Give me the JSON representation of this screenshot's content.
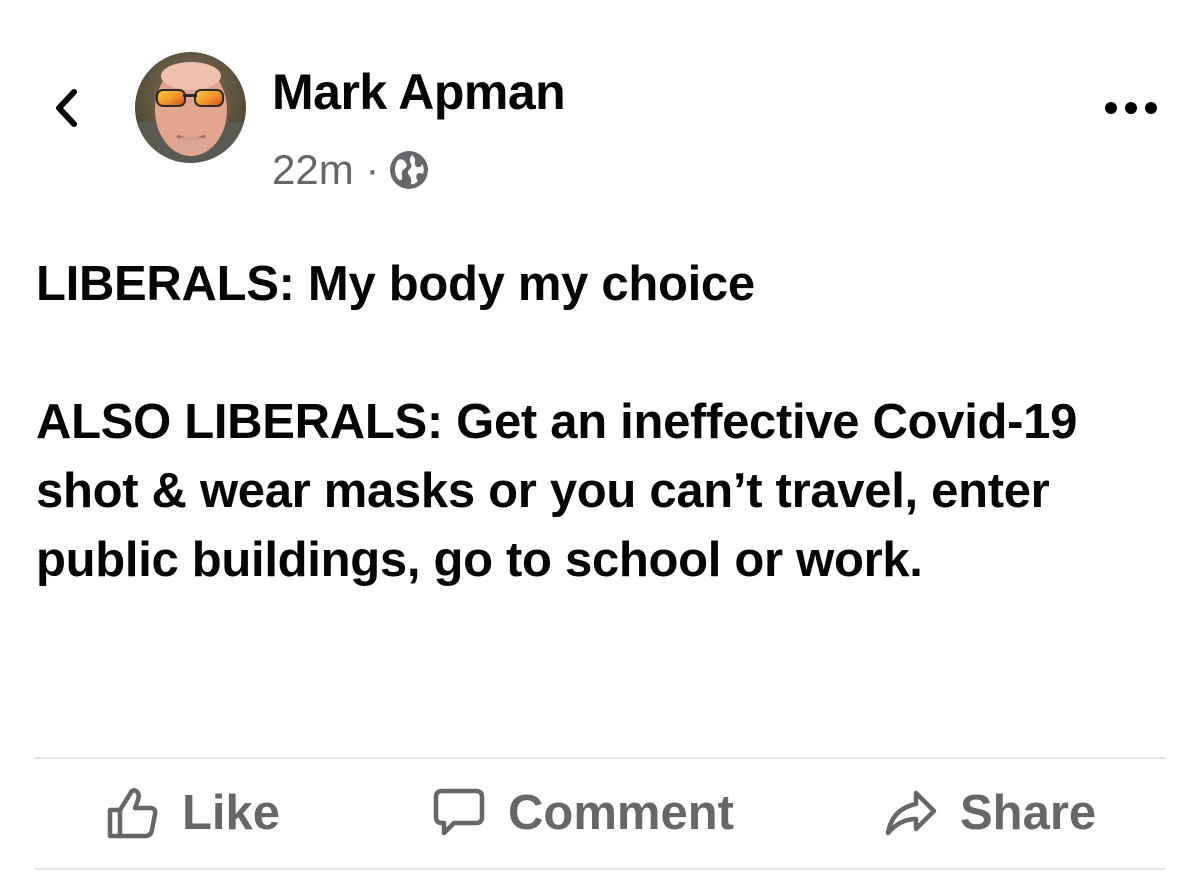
{
  "header": {
    "back_icon": "chevron-left-icon",
    "more_icon": "more-horizontal-icon"
  },
  "author": {
    "name": "Mark Apman",
    "avatar_icon": "avatar-photo"
  },
  "meta": {
    "time": "22m",
    "separator": "·",
    "privacy_icon": "globe-icon"
  },
  "post": {
    "line1": "LIBERALS: My body my choice",
    "line2": "ALSO LIBERALS: Get an ineffective Covid-19 shot & wear masks or you can’t travel, enter public buildings, go to school or work."
  },
  "actions": {
    "like_label": "Like",
    "comment_label": "Comment",
    "share_label": "Share",
    "like_icon": "thumbs-up-icon",
    "comment_icon": "comment-bubble-icon",
    "share_icon": "share-arrow-icon"
  },
  "colors": {
    "text": "#050505",
    "secondary": "#65676b",
    "divider": "#e4e6eb"
  }
}
